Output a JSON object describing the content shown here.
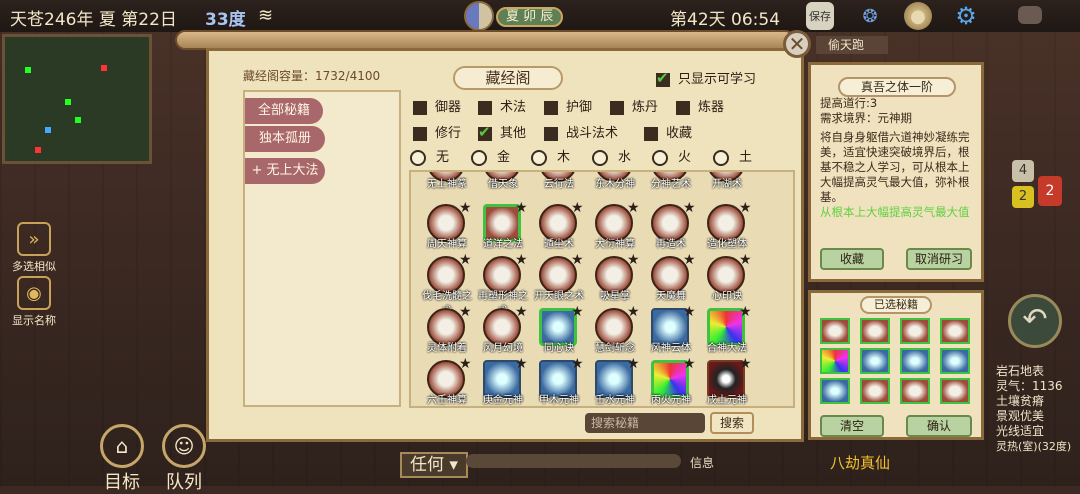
{
  "header": {
    "date": "天苍246年 夏 第22日",
    "temp": "33度",
    "season_badge": "夏 卯 辰",
    "day_time": "第42天 06:54",
    "save_label": "保存"
  },
  "side": {
    "multi_select": "多选相似",
    "show_names": "显示名称",
    "target": "目标",
    "queue": "队列",
    "any": "任何",
    "info": "信息",
    "stage": "八劫真仙",
    "thief_tag": "偷天跑"
  },
  "panel": {
    "capacity": "藏经阁容量：1732/4100",
    "title": "藏经阁",
    "only_learnable": "只显示可学习",
    "tabs": [
      "全部秘籍",
      "独本孤册",
      "无上大法"
    ],
    "filters": [
      {
        "label": "御器",
        "on": false
      },
      {
        "label": "术法",
        "on": false
      },
      {
        "label": "护御",
        "on": false
      },
      {
        "label": "炼丹",
        "on": false
      },
      {
        "label": "炼器",
        "on": false
      },
      {
        "label": "修行",
        "on": false
      },
      {
        "label": "其他",
        "on": true
      },
      {
        "label": "战斗法术",
        "on": false
      },
      {
        "label": "收藏",
        "on": false
      }
    ],
    "elements": [
      "无",
      "金",
      "木",
      "水",
      "火",
      "土"
    ],
    "search_placeholder": "搜索秘籍",
    "search_btn": "搜索",
    "row0": [
      "无上神篆",
      "借天象",
      "云行法",
      "东木分神",
      "分神艺术",
      "开湖术"
    ],
    "items": [
      [
        "周天神算",
        "道洋之法",
        "遁尘术",
        "大衍神算",
        "再造术",
        "造化塑体"
      ],
      [
        "伐毛洗髓之术",
        "再塑形神之术",
        "开天眼之术",
        "吸星掌",
        "天魔舞",
        "心印诀"
      ],
      [
        "灵体附着",
        "风月幻境",
        "同心诀",
        "慧剑斩念",
        "风神云体",
        "合神大法"
      ],
      [
        "六壬神算",
        "庚金元神",
        "甲木元神",
        "壬水元神",
        "丙火元神",
        "戊土元神"
      ]
    ]
  },
  "detail": {
    "title": "真吾之体一阶",
    "lines": [
      "提高道行:3",
      "需求境界：元神期",
      "将自身身躯借六道神妙凝练完美，适宜快速突破境界后，根基不稳之人学习，可从根本上大幅提高灵气最大值，弥补根基。"
    ],
    "highlight": "从根本上大幅提高灵气最大值",
    "collect": "收藏",
    "cancel_research": "取消研习"
  },
  "selected": {
    "title": "已选秘籍",
    "clear": "清空",
    "confirm": "确认"
  },
  "hud": {
    "terrain": "岩石地表",
    "lingqi": "灵气：1136",
    "soil": "土壤贫瘠",
    "view": "景观优美",
    "light": "光线适宜",
    "heat": "灵热(室)(32度)",
    "n4": "4",
    "n2a": "2",
    "n2b": "2"
  }
}
